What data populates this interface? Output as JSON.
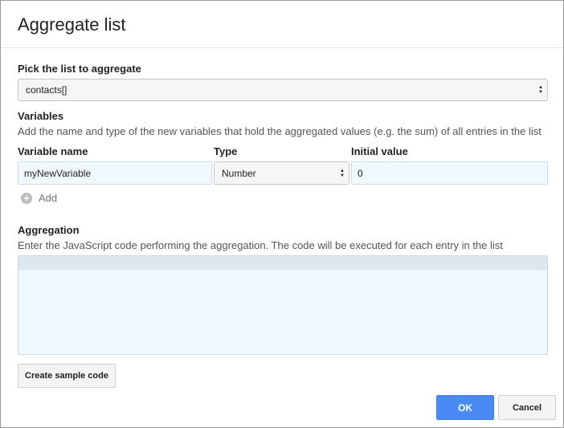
{
  "dialog": {
    "title": "Aggregate list"
  },
  "list_section": {
    "label": "Pick the list to aggregate",
    "selected_list": "contacts[]"
  },
  "variables_section": {
    "heading": "Variables",
    "description": "Add the name and type of the new variables that hold the aggregated values (e.g. the sum) of all entries in the list",
    "columns": {
      "name": "Variable name",
      "type": "Type",
      "initial": "Initial value"
    },
    "rows": [
      {
        "name": "myNewVariable",
        "type": "Number",
        "initial": "0"
      }
    ],
    "add_label": "Add"
  },
  "aggregation_section": {
    "heading": "Aggregation",
    "description": "Enter the JavaScript code performing the aggregation. The code will be executed for each entry in the list",
    "code": ""
  },
  "buttons": {
    "sample_code": "Create sample code",
    "ok": "OK",
    "cancel": "Cancel"
  },
  "colors": {
    "primary": "#4a8af4",
    "input_bg": "#f0f9ff"
  }
}
